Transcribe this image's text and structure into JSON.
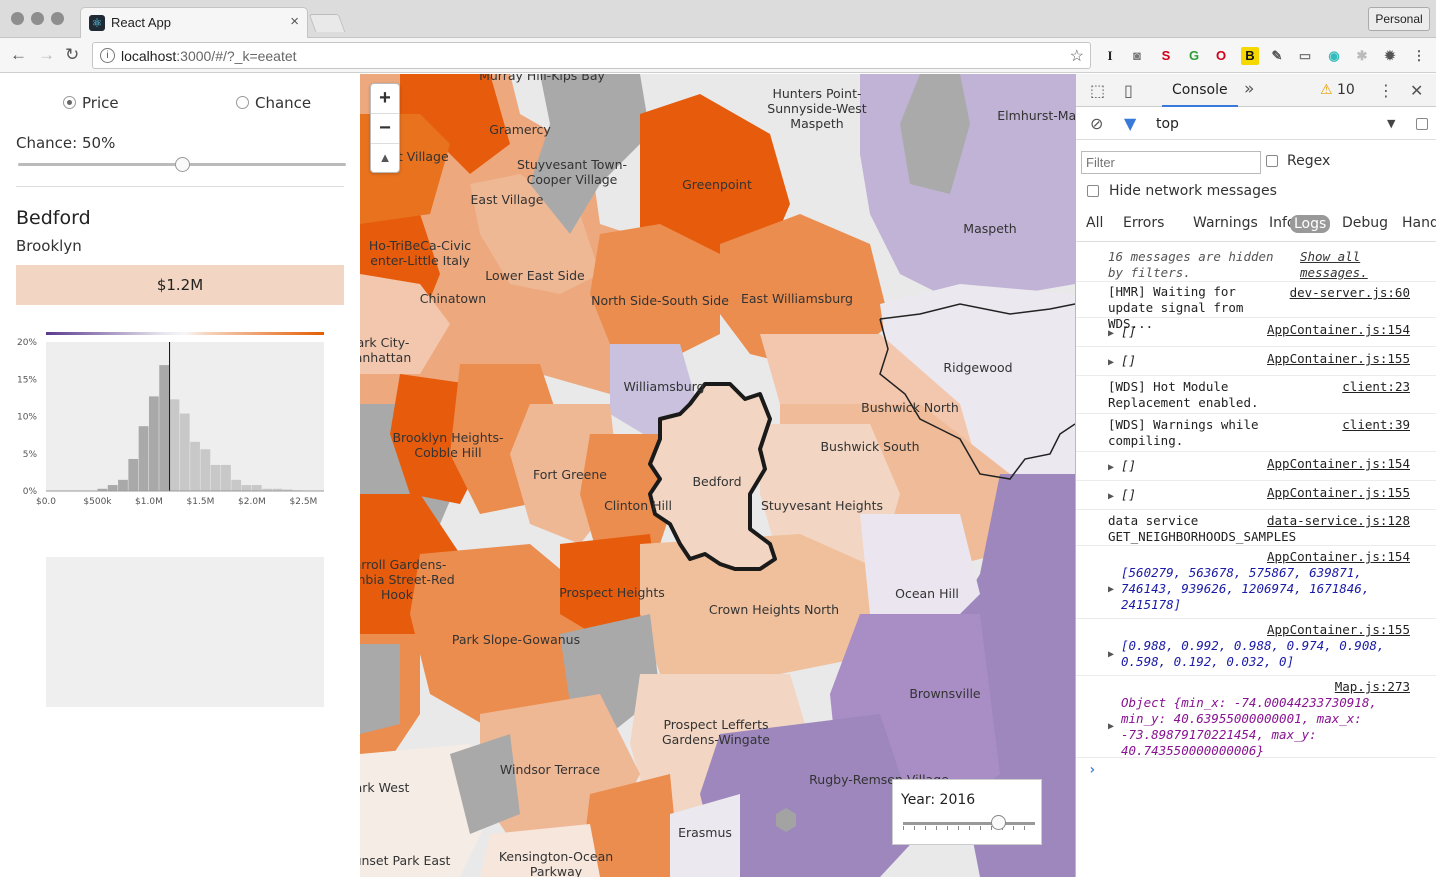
{
  "browser": {
    "tab_title": "React App",
    "profile": "Personal",
    "url_host": "localhost",
    "url_rest": ":3000/#/?_k=eeatet"
  },
  "panel": {
    "radio_price": "Price",
    "radio_chance": "Chance",
    "selected_mode": "Price",
    "chance_label": "Chance: 50%",
    "chance_value": 0.5,
    "neighborhood": "Bedford",
    "borough": "Brooklyn",
    "price": "$1.2M"
  },
  "chart_data": {
    "type": "bar",
    "title": "",
    "xlabel": "",
    "ylabel": "",
    "x_ticks": [
      "$0.0",
      "$500k",
      "$1.0M",
      "$1.5M",
      "$2.0M",
      "$2.5M"
    ],
    "y_ticks": [
      "0%",
      "5%",
      "10%",
      "15%",
      "20%"
    ],
    "ylim": [
      0,
      20
    ],
    "xlim": [
      0,
      2700000
    ],
    "bin_width": 100000,
    "bins_start": [
      500000,
      600000,
      700000,
      800000,
      900000,
      1000000,
      1100000,
      1200000,
      1300000,
      1400000,
      1500000,
      1600000,
      1700000,
      1800000,
      1900000,
      2000000,
      2100000,
      2200000,
      2300000,
      2400000
    ],
    "values": [
      0.3,
      0.8,
      1.5,
      4.3,
      8.7,
      12.7,
      16.9,
      12.3,
      10.4,
      6.6,
      5.6,
      3.5,
      3.5,
      1.5,
      0.8,
      0.8,
      0.3,
      0.3,
      0.2,
      0.1
    ],
    "marker": 1200000,
    "grid": false
  },
  "map": {
    "labels": [
      {
        "text": "Murray Hill-Kips Bay"
      },
      {
        "text": "Hunters Point-"
      },
      {
        "text": "Sunnyside-West"
      },
      {
        "text": "Maspeth"
      },
      {
        "text": "Elmhurst-Mas"
      },
      {
        "text": "Gramercy"
      },
      {
        "text": "st Village"
      },
      {
        "text": "Stuyvesant Town-"
      },
      {
        "text": "Cooper Village"
      },
      {
        "text": "Greenpoint"
      },
      {
        "text": "East Village"
      },
      {
        "text": "Maspeth"
      },
      {
        "text": "Ho-TriBeCa-Civic"
      },
      {
        "text": "enter-Little Italy"
      },
      {
        "text": "Lower East Side"
      },
      {
        "text": "Chinatown"
      },
      {
        "text": "North Side-South Side"
      },
      {
        "text": "East Williamsburg"
      },
      {
        "text": "ark City-"
      },
      {
        "text": "anhattan"
      },
      {
        "text": "Ridgewood"
      },
      {
        "text": "Williamsburg"
      },
      {
        "text": "Bushwick North"
      },
      {
        "text": "Brooklyn Heights-"
      },
      {
        "text": "Cobble Hill"
      },
      {
        "text": "Bushwick South"
      },
      {
        "text": "Fort Greene"
      },
      {
        "text": "Bedford"
      },
      {
        "text": "Clinton Hill"
      },
      {
        "text": "Stuyvesant Heights"
      },
      {
        "text": "arroll Gardens-"
      },
      {
        "text": "umbia Street-Red"
      },
      {
        "text": "Hook"
      },
      {
        "text": "Prospect Heights"
      },
      {
        "text": "Ocean Hill"
      },
      {
        "text": "Crown Heights North"
      },
      {
        "text": "Park Slope-Gowanus"
      },
      {
        "text": "Brownsville"
      },
      {
        "text": "Prospect Lefferts"
      },
      {
        "text": "Gardens-Wingate"
      },
      {
        "text": "Windsor Terrace"
      },
      {
        "text": "Rugby-Remsen Village"
      },
      {
        "text": "ark West"
      },
      {
        "text": "Erasmus"
      },
      {
        "text": "Kensington-Ocean"
      },
      {
        "text": "Parkway"
      },
      {
        "text": "unset Park East"
      }
    ],
    "zoom_in": "+",
    "zoom_out": "−",
    "compass": "▲",
    "year_label": "Year: 2016",
    "year_value": 0.74
  },
  "devtools": {
    "tab": "Console",
    "warnings_count": "10",
    "context": "top",
    "filter_placeholder": "Filter",
    "regex": "Regex",
    "hide_network": "Hide network messages",
    "levels": [
      "All",
      "Errors",
      "Warnings",
      "Info",
      "Logs",
      "Debug",
      "Hand"
    ],
    "hidden_msg": "16 messages are hidden by filters.",
    "show_all": "Show all messages.",
    "logs": [
      {
        "text": "[HMR] Waiting for update signal from WDS...",
        "src": "dev-server.js:60"
      },
      {
        "text": "[]",
        "src": "AppContainer.js:154"
      },
      {
        "text": "[]",
        "src": "AppContainer.js:155"
      },
      {
        "text": "[WDS] Hot Module Replacement enabled.",
        "src": "client:23"
      },
      {
        "text": "[WDS] Warnings while compiling.",
        "src": "client:39"
      },
      {
        "text": "[]",
        "src": "AppContainer.js:154"
      },
      {
        "text": "[]",
        "src": "AppContainer.js:155"
      },
      {
        "text": "data service GET_NEIGHBORHOODS_SAMPLES",
        "src": "data-service.js:128"
      },
      {
        "text": "[560279, 563678, 575867, 639871, 746143, 939626, 1206974, 1671846, 2415178]",
        "src": "AppContainer.js:154"
      },
      {
        "text": "[0.988, 0.992, 0.988, 0.974, 0.908, 0.598, 0.192, 0.032, 0]",
        "src": "AppContainer.js:155"
      },
      {
        "text": "Object {min_x: -74.00044233730918, min_y: 40.63955000000001, max_x: -73.89879170221454, max_y: 40.743550000000006}",
        "src": "Map.js:273"
      }
    ]
  }
}
